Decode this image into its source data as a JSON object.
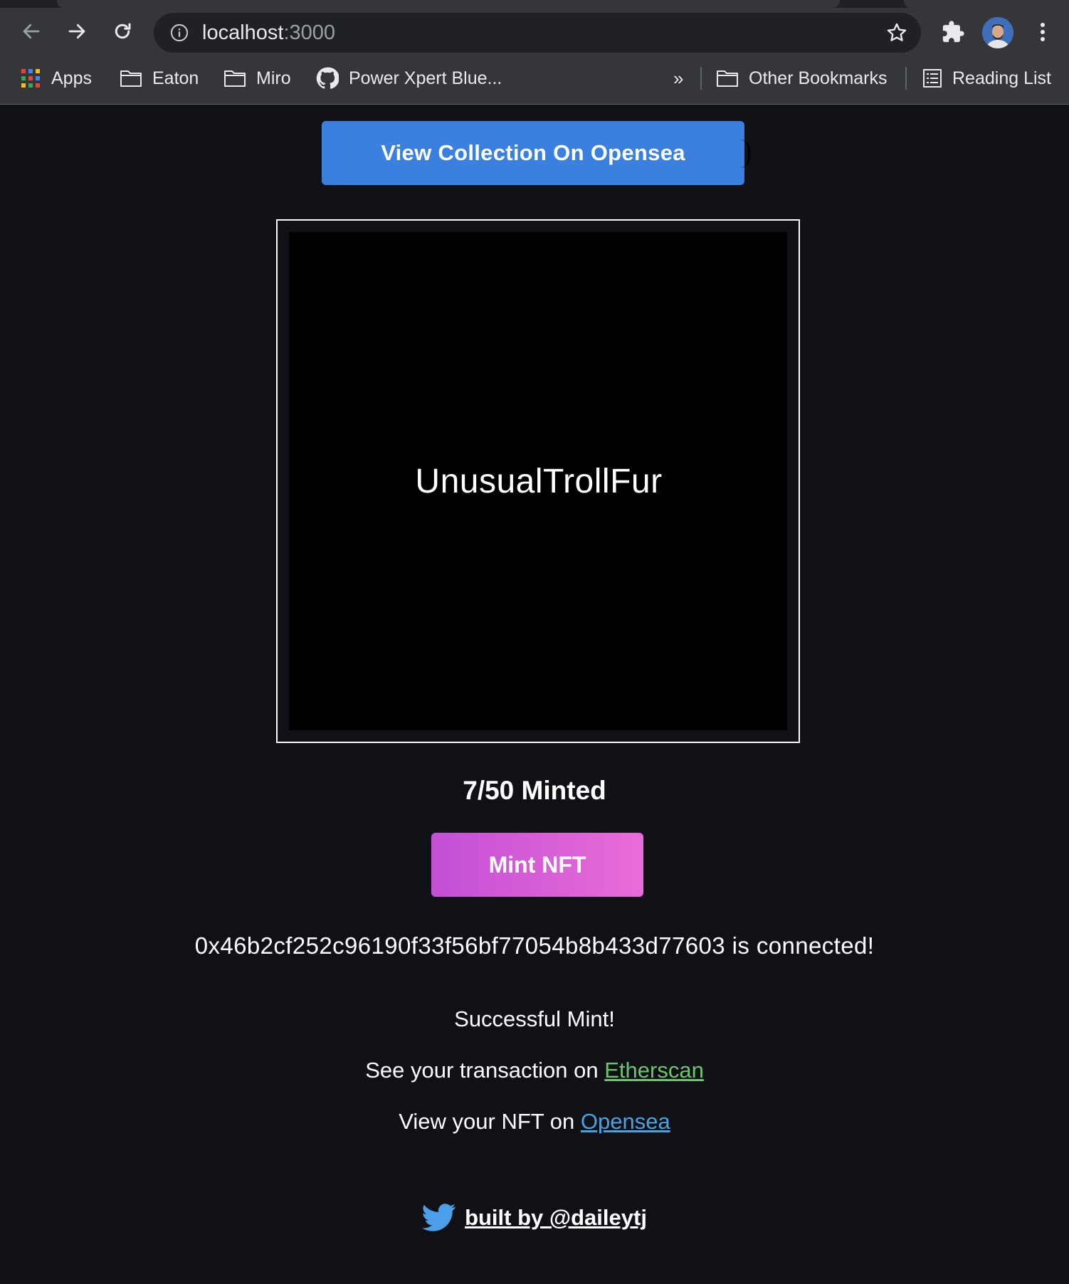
{
  "browser": {
    "url_host": "localhost",
    "url_port": ":3000",
    "bookmarks": [
      {
        "label": "Apps",
        "icon": "apps-grid-icon"
      },
      {
        "label": "Eaton",
        "icon": "folder-icon"
      },
      {
        "label": "Miro",
        "icon": "folder-icon"
      },
      {
        "label": "Power Xpert Blue...",
        "icon": "github-icon"
      }
    ],
    "overflow_label": "»",
    "other_bookmarks": "Other Bookmarks",
    "reading_list": "Reading List"
  },
  "page": {
    "view_collection_label": "View Collection On Opensea",
    "nft_name": "UnusualTrollFur",
    "minted_count": "7/50 Minted",
    "mint_button_label": "Mint NFT",
    "connected_message": "0x46b2cf252c96190f33f56bf77054b8b433d77603 is connected!",
    "success_message": "Successful Mint!",
    "etherscan_prefix": "See your transaction on ",
    "etherscan_link": "Etherscan",
    "opensea_prefix": "View your NFT on ",
    "opensea_link": "Opensea",
    "footer_link": "built by @daileytj"
  },
  "colors": {
    "background": "#0f1116",
    "opensea_button": "#3b80de",
    "mint_gradient_start": "#c24fd6",
    "mint_gradient_end": "#e96dd7",
    "etherscan_link": "#6fc36c",
    "opensea_link": "#4aa3df",
    "twitter": "#4a9fe8"
  }
}
